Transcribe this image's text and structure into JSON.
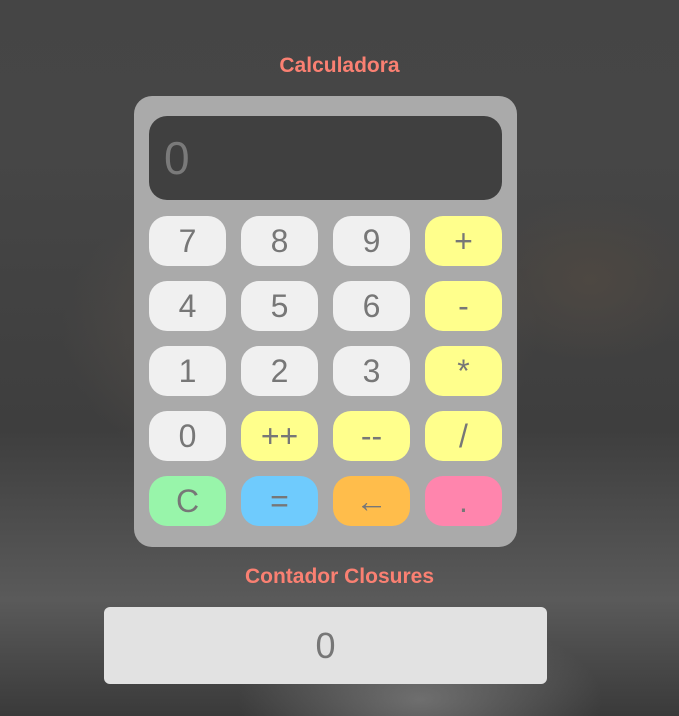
{
  "calculator": {
    "title": "Calculadora",
    "display_value": "0",
    "keys": [
      {
        "label": "7",
        "kind": "num",
        "name": "key-7"
      },
      {
        "label": "8",
        "kind": "num",
        "name": "key-8"
      },
      {
        "label": "9",
        "kind": "num",
        "name": "key-9"
      },
      {
        "label": "+",
        "kind": "op",
        "name": "key-plus"
      },
      {
        "label": "4",
        "kind": "num",
        "name": "key-4"
      },
      {
        "label": "5",
        "kind": "num",
        "name": "key-5"
      },
      {
        "label": "6",
        "kind": "num",
        "name": "key-6"
      },
      {
        "label": "-",
        "kind": "op",
        "name": "key-minus"
      },
      {
        "label": "1",
        "kind": "num",
        "name": "key-1"
      },
      {
        "label": "2",
        "kind": "num",
        "name": "key-2"
      },
      {
        "label": "3",
        "kind": "num",
        "name": "key-3"
      },
      {
        "label": "*",
        "kind": "op",
        "name": "key-multiply"
      },
      {
        "label": "0",
        "kind": "num",
        "name": "key-0"
      },
      {
        "label": "++",
        "kind": "op",
        "name": "key-increment"
      },
      {
        "label": "--",
        "kind": "op",
        "name": "key-decrement"
      },
      {
        "label": "/",
        "kind": "op",
        "name": "key-divide"
      },
      {
        "label": "C",
        "kind": "clear",
        "name": "key-clear"
      },
      {
        "label": "=",
        "kind": "eq",
        "name": "key-equals"
      },
      {
        "label": "←",
        "kind": "back",
        "name": "key-backspace"
      },
      {
        "label": ".",
        "kind": "dot",
        "name": "key-decimal"
      }
    ]
  },
  "counter": {
    "title": "Contador Closures",
    "value": "0"
  },
  "colors": {
    "title": "#fa8072",
    "key_number": "#f0f0f0",
    "key_operator": "#ffff8c",
    "key_clear": "#98f5aa",
    "key_equals": "#6fcbfd",
    "key_backspace": "#ffbd4b",
    "key_decimal": "#ff85ad"
  }
}
